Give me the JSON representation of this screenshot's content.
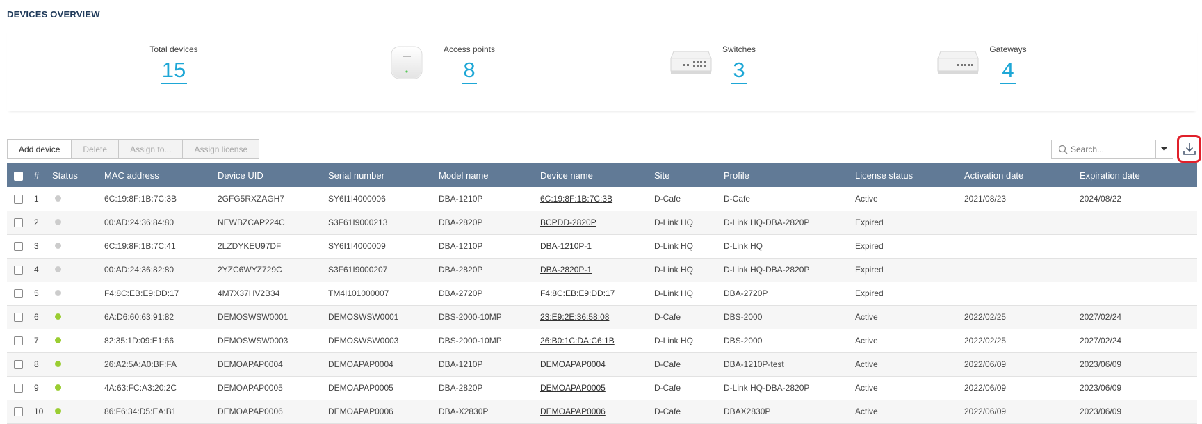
{
  "page": {
    "title": "DEVICES OVERVIEW"
  },
  "stats": [
    {
      "label": "Total devices",
      "value": "15"
    },
    {
      "label": "Access points",
      "value": "8"
    },
    {
      "label": "Switches",
      "value": "3"
    },
    {
      "label": "Gateways",
      "value": "4"
    }
  ],
  "toolbar": {
    "add_device": "Add device",
    "delete": "Delete",
    "assign_to": "Assign to...",
    "assign_license": "Assign license"
  },
  "search": {
    "placeholder": "Search..."
  },
  "colors": {
    "online": "#9acd32",
    "offline": "#cccccc",
    "header": "#617a96",
    "accent": "#1ea7d6"
  },
  "table": {
    "headers": [
      "#",
      "Status",
      "MAC address",
      "Device UID",
      "Serial number",
      "Model name",
      "Device name",
      "Site",
      "Profile",
      "License status",
      "Activation date",
      "Expiration date"
    ],
    "rows": [
      {
        "n": "1",
        "status": "offline",
        "mac": "6C:19:8F:1B:7C:3B",
        "uid": "2GFG5RXZAGH7",
        "serial": "SY6I1I4000006",
        "model": "DBA-1210P",
        "name": "6C:19:8F:1B:7C:3B",
        "site": "D-Cafe",
        "profile": "D-Cafe",
        "license": "Active",
        "activation": "2021/08/23",
        "expiration": "2024/08/22"
      },
      {
        "n": "2",
        "status": "offline",
        "mac": "00:AD:24:36:84:80",
        "uid": "NEWBZCAP224C",
        "serial": "S3F61I9000213",
        "model": "DBA-2820P",
        "name": "BCPDD-2820P",
        "site": "D-Link HQ",
        "profile": "D-Link HQ-DBA-2820P",
        "license": "Expired",
        "activation": "",
        "expiration": ""
      },
      {
        "n": "3",
        "status": "offline",
        "mac": "6C:19:8F:1B:7C:41",
        "uid": "2LZDYKEU97DF",
        "serial": "SY6I1I4000009",
        "model": "DBA-1210P",
        "name": "DBA-1210P-1",
        "site": "D-Link HQ",
        "profile": "D-Link HQ",
        "license": "Expired",
        "activation": "",
        "expiration": ""
      },
      {
        "n": "4",
        "status": "offline",
        "mac": "00:AD:24:36:82:80",
        "uid": "2YZC6WYZ729C",
        "serial": "S3F61I9000207",
        "model": "DBA-2820P",
        "name": "DBA-2820P-1",
        "site": "D-Link HQ",
        "profile": "D-Link HQ-DBA-2820P",
        "license": "Expired",
        "activation": "",
        "expiration": ""
      },
      {
        "n": "5",
        "status": "offline",
        "mac": "F4:8C:EB:E9:DD:17",
        "uid": "4M7X37HV2B34",
        "serial": "TM4I101000007",
        "model": "DBA-2720P",
        "name": "F4:8C:EB:E9:DD:17",
        "site": "D-Link HQ",
        "profile": "DBA-2720P",
        "license": "Expired",
        "activation": "",
        "expiration": ""
      },
      {
        "n": "6",
        "status": "online",
        "mac": "6A:D6:60:63:91:82",
        "uid": "DEMOSWSW0001",
        "serial": "DEMOSWSW0001",
        "model": "DBS-2000-10MP",
        "name": "23:E9:2E:36:58:08",
        "site": "D-Cafe",
        "profile": "DBS-2000",
        "license": "Active",
        "activation": "2022/02/25",
        "expiration": "2027/02/24"
      },
      {
        "n": "7",
        "status": "online",
        "mac": "82:35:1D:09:E1:66",
        "uid": "DEMOSWSW0003",
        "serial": "DEMOSWSW0003",
        "model": "DBS-2000-10MP",
        "name": "26:B0:1C:DA:C6:1B",
        "site": "D-Link HQ",
        "profile": "DBS-2000",
        "license": "Active",
        "activation": "2022/02/25",
        "expiration": "2027/02/24"
      },
      {
        "n": "8",
        "status": "online",
        "mac": "26:A2:5A:A0:BF:FA",
        "uid": "DEMOAPAP0004",
        "serial": "DEMOAPAP0004",
        "model": "DBA-1210P",
        "name": "DEMOAPAP0004",
        "site": "D-Cafe",
        "profile": "DBA-1210P-test",
        "license": "Active",
        "activation": "2022/06/09",
        "expiration": "2023/06/09"
      },
      {
        "n": "9",
        "status": "online",
        "mac": "4A:63:FC:A3:20:2C",
        "uid": "DEMOAPAP0005",
        "serial": "DEMOAPAP0005",
        "model": "DBA-2820P",
        "name": "DEMOAPAP0005",
        "site": "D-Cafe",
        "profile": "D-Link HQ-DBA-2820P",
        "license": "Active",
        "activation": "2022/06/09",
        "expiration": "2023/06/09"
      },
      {
        "n": "10",
        "status": "online",
        "mac": "86:F6:34:D5:EA:B1",
        "uid": "DEMOAPAP0006",
        "serial": "DEMOAPAP0006",
        "model": "DBA-X2830P",
        "name": "DEMOAPAP0006",
        "site": "D-Cafe",
        "profile": "DBAX2830P",
        "license": "Active",
        "activation": "2022/06/09",
        "expiration": "2023/06/09"
      }
    ]
  }
}
